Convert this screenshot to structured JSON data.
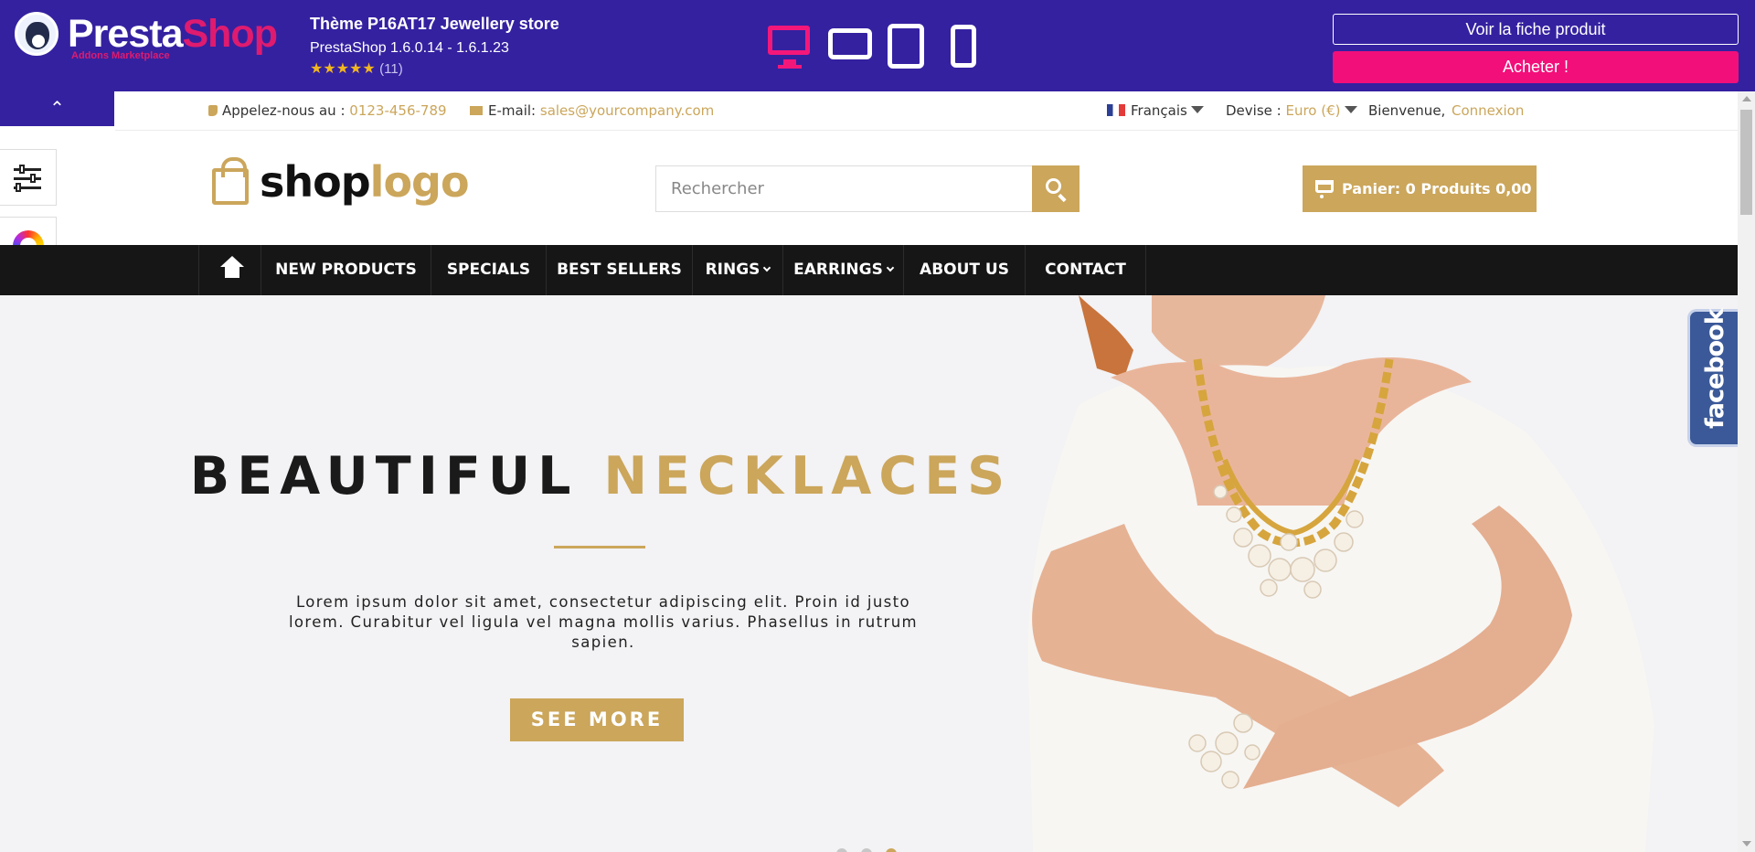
{
  "ps_bar": {
    "logo_word_1": "Presta",
    "logo_word_2": "Shop",
    "logo_sub": "Addons Marketplace",
    "theme_title": "Thème P16AT17 Jewellery store",
    "theme_versions": "PrestaShop 1.6.0.14 - 1.6.1.23",
    "rating_stars": "★★★★★",
    "rating_count": "(11)",
    "rating_value": 5,
    "view_product_label": "Voir la fiche produit",
    "buy_label": "Acheter !",
    "collapse_icon": "⌃",
    "devices": [
      "desktop-icon",
      "tablet-landscape-icon",
      "tablet-portrait-icon",
      "phone-icon"
    ],
    "active_device": "desktop",
    "brand_color": "#3421a0",
    "accent_pink": "#f20f7a"
  },
  "topinfo": {
    "phone_label": "Appelez-nous au :",
    "phone_value": "0123-456-789",
    "email_label": "E-mail:",
    "email_value": "sales@yourcompany.com",
    "language": "Français",
    "currency_label": "Devise :",
    "currency_value": "Euro (€)",
    "welcome": "Bienvenue,",
    "login": "Connexion"
  },
  "header": {
    "logo_part_1": "shop",
    "logo_part_2": "logo",
    "search_placeholder": "Rechercher",
    "cart_label": "Panier: 0 Produits 0,00 €",
    "accent_gold": "#cba65b"
  },
  "nav": {
    "items": [
      {
        "label": "NEW PRODUCTS"
      },
      {
        "label": "SPECIALS"
      },
      {
        "label": "BEST SELLERS"
      },
      {
        "label": "RINGS"
      },
      {
        "label": "EARRINGS"
      },
      {
        "label": "ABOUT US"
      },
      {
        "label": "CONTACT"
      }
    ]
  },
  "hero": {
    "title_dark": "BEAUTIFUL",
    "title_gold": "NECKLACES",
    "text": "Lorem ipsum dolor sit amet, consectetur adipiscing elit. Proin id justo lorem. Curabitur vel ligula vel magna mollis varius. Phasellus in rutrum sapien.",
    "button_label": "SEE MORE",
    "slide_count": 3,
    "active_slide": 3
  },
  "facebook_tab": {
    "label": "facebook"
  }
}
